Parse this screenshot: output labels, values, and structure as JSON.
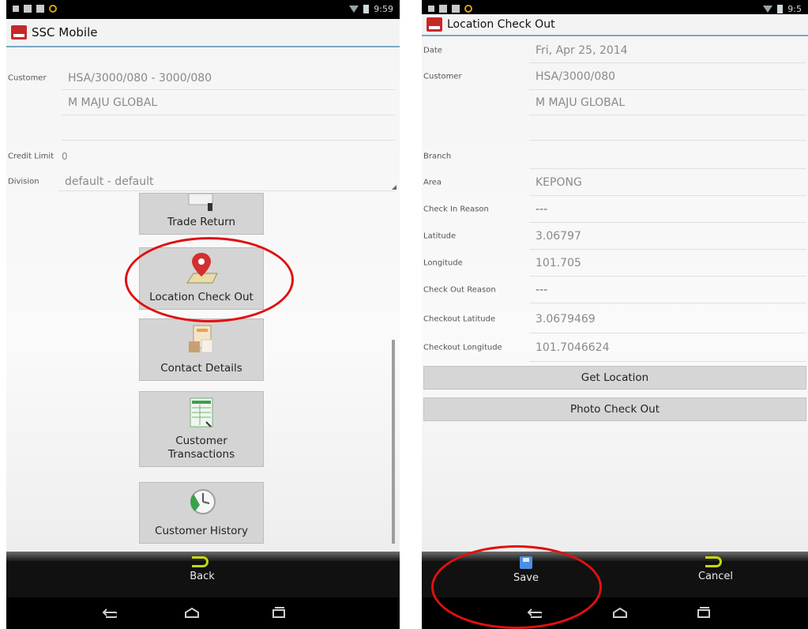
{
  "left_screen": {
    "status_time": "9:59",
    "app_title": "SSC Mobile",
    "customer_label": "Customer",
    "customer_code": "HSA/3000/080 - 3000/080",
    "customer_name": "M MAJU GLOBAL",
    "credit_limit_label": "Credit Limit",
    "credit_limit_value": "0",
    "division_label": "Division",
    "division_value": "default - default",
    "tiles": [
      {
        "label": "Trade Return",
        "icon": "trade-return-icon"
      },
      {
        "label": "Location Check Out",
        "icon": "location-pin-icon"
      },
      {
        "label": "Contact Details",
        "icon": "contact-card-icon"
      },
      {
        "label": "Customer\nTransactions",
        "icon": "spreadsheet-icon"
      },
      {
        "label": "Customer History",
        "icon": "clock-history-icon"
      }
    ],
    "bottom_button": "Back"
  },
  "right_screen": {
    "status_time": "9:5",
    "title": "Location Check Out",
    "fields": [
      {
        "label": "Date",
        "value": "Fri, Apr 25, 2014"
      },
      {
        "label": "Customer",
        "value": "HSA/3000/080"
      },
      {
        "label": "",
        "value": "M MAJU GLOBAL"
      },
      {
        "label": "",
        "value": ""
      },
      {
        "label": "Branch",
        "value": ""
      },
      {
        "label": "Area",
        "value": "KEPONG"
      },
      {
        "label": "Check In Reason",
        "value": "---"
      },
      {
        "label": "Latitude",
        "value": "3.06797"
      },
      {
        "label": "Longitude",
        "value": "101.705"
      },
      {
        "label": "Check Out Reason",
        "value": "---"
      },
      {
        "label": "Checkout Latitude",
        "value": "3.0679469"
      },
      {
        "label": "Checkout Longitude",
        "value": "101.7046624"
      }
    ],
    "get_location_button": "Get Location",
    "photo_checkout_button": "Photo Check Out",
    "save_button": "Save",
    "cancel_button": "Cancel"
  },
  "colors": {
    "highlight": "#e01010",
    "title_rule": "#7aa7c7",
    "back_arrow": "#c6d90a",
    "save_icon": "#4a90e2"
  }
}
